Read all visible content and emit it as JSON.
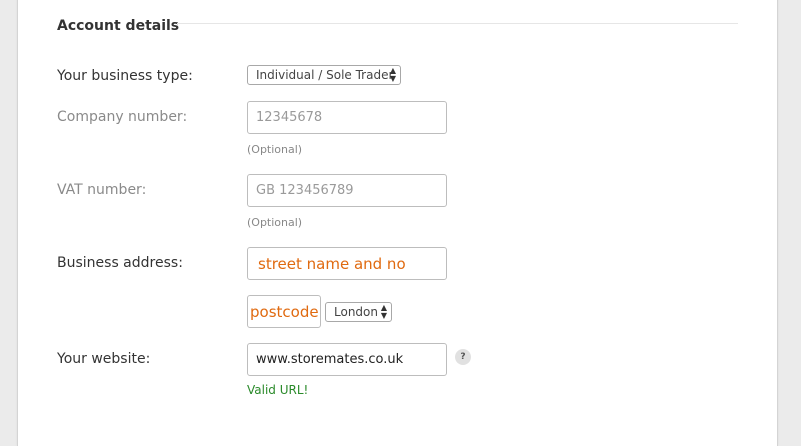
{
  "section": {
    "title": "Account details"
  },
  "fields": {
    "business_type": {
      "label": "Your business type:",
      "value": "Individual / Sole Trader"
    },
    "company_number": {
      "label": "Company number:",
      "placeholder": "12345678",
      "hint": "(Optional)"
    },
    "vat_number": {
      "label": "VAT number:",
      "placeholder": "GB 123456789",
      "hint": "(Optional)"
    },
    "business_address": {
      "label": "Business address:",
      "street": "street name and no",
      "postcode": "postcode",
      "city": "London"
    },
    "website": {
      "label": "Your website:",
      "value": "www.storemates.co.uk",
      "status": "Valid URL!",
      "help": "?"
    }
  },
  "colors": {
    "accent_orange": "#e06a10",
    "valid_green": "#2a8a2a"
  },
  "icons": {
    "select_arrows": "up-down-chevron-icon",
    "help": "question-mark-icon"
  }
}
